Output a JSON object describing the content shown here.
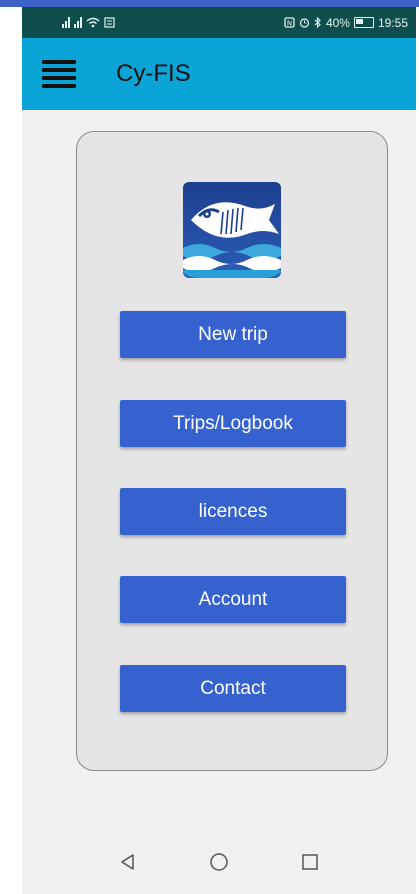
{
  "status_bar": {
    "battery": "40%",
    "time": "19:55"
  },
  "app_bar": {
    "title": "Cy-FIS"
  },
  "menu": {
    "items": [
      {
        "label": "New trip"
      },
      {
        "label": "Trips/Logbook"
      },
      {
        "label": "licences"
      },
      {
        "label": "Account"
      },
      {
        "label": "Contact"
      }
    ]
  },
  "colors": {
    "status_bar": "#0e4f4d",
    "app_bar": "#0aa5d6",
    "button": "#3662d0",
    "card": "#e5e5e5"
  },
  "icons": [
    "signal-icon",
    "wifi-icon",
    "nfc-icon",
    "alarm-icon",
    "bluetooth-icon",
    "battery-icon",
    "hamburger-menu-icon",
    "fish-logo-icon",
    "back-icon",
    "home-icon",
    "recents-icon"
  ]
}
